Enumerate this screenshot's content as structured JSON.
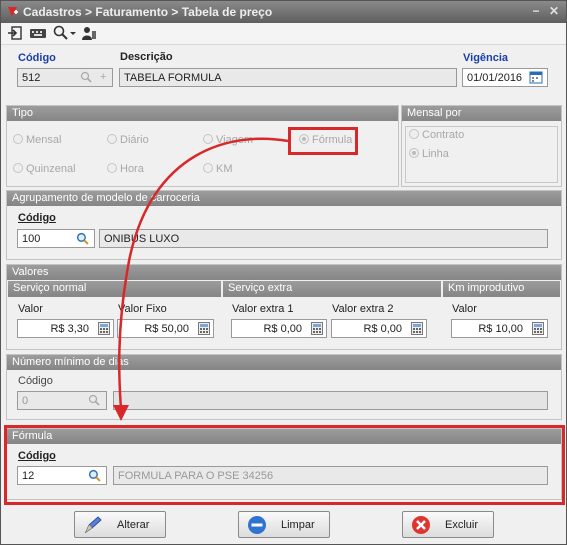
{
  "window": {
    "title": "Cadastros > Faturamento > Tabela de preço"
  },
  "header": {
    "codigo_label": "Código",
    "codigo_value": "512",
    "descricao_label": "Descrição",
    "descricao_value": "TABELA FORMULA",
    "vigencia_label": "Vigência",
    "vigencia_value": "01/01/2016"
  },
  "tipo": {
    "title": "Tipo",
    "options": [
      "Mensal",
      "Diário",
      "Viagem",
      "Fórmula",
      "Quinzenal",
      "Hora",
      "KM"
    ],
    "selected": "Fórmula"
  },
  "mensal_por": {
    "title": "Mensal por",
    "options": [
      "Contrato",
      "Linha"
    ],
    "selected": "Linha"
  },
  "agrupamento": {
    "title": "Agrupamento de modelo de carroceria",
    "codigo_label": "Código",
    "codigo_value": "100",
    "descricao_value": "ONIBUS LUXO"
  },
  "valores": {
    "title": "Valores",
    "servico_normal": {
      "title": "Serviço normal",
      "valor_label": "Valor",
      "valor_value": "R$ 3,30",
      "valor_fixo_label": "Valor Fixo",
      "valor_fixo_value": "R$ 50,00"
    },
    "servico_extra": {
      "title": "Serviço extra",
      "extra1_label": "Valor extra 1",
      "extra1_value": "R$ 0,00",
      "extra2_label": "Valor extra 2",
      "extra2_value": "R$ 0,00"
    },
    "km_improdutivo": {
      "title": "Km improdutivo",
      "valor_label": "Valor",
      "valor_value": "R$ 10,00"
    }
  },
  "numero_minimo": {
    "title": "Número mínimo de dias",
    "codigo_label": "Código",
    "codigo_value": "0",
    "descricao_value": ""
  },
  "formula": {
    "title": "Fórmula",
    "codigo_label": "Código",
    "codigo_value": "12",
    "descricao_value": "FORMULA PARA O PSE 34256"
  },
  "buttons": {
    "alterar": "Alterar",
    "limpar": "Limpar",
    "excluir": "Excluir"
  },
  "colors": {
    "highlight": "#d8282a",
    "title_bar": "#6e6e6e",
    "section_header": "#8f8f8f",
    "label_blue": "#1b3fa8"
  }
}
